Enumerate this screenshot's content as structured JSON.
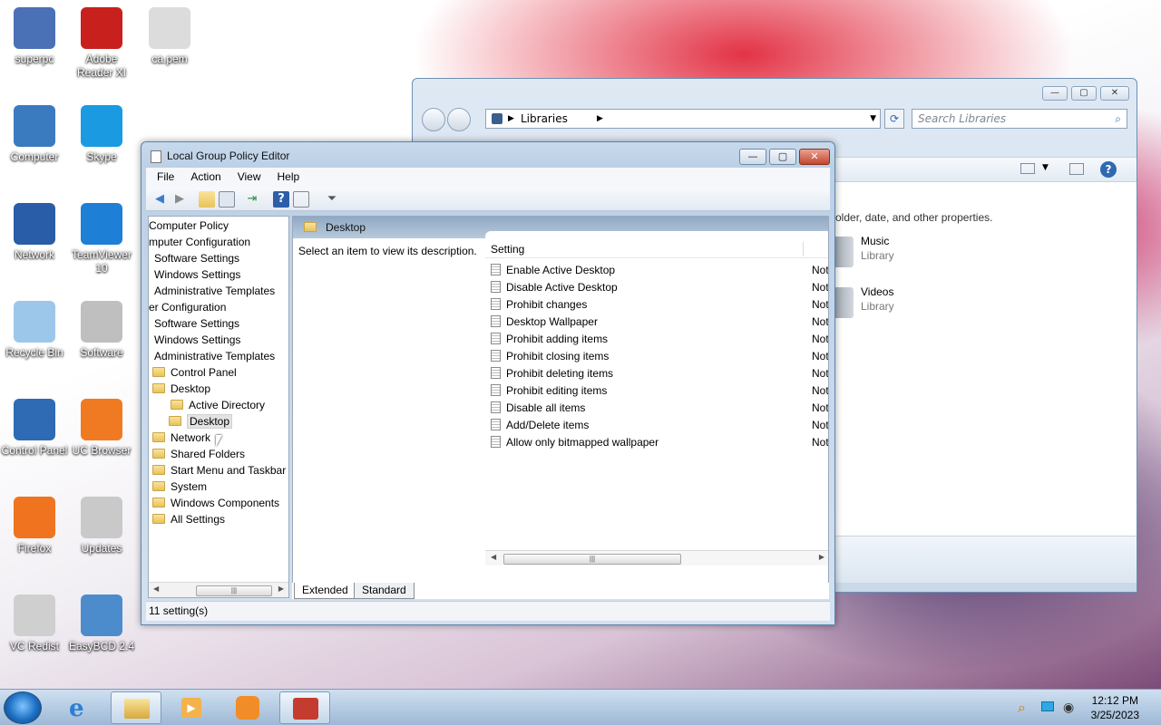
{
  "desktop": {
    "icons": [
      {
        "label": "superpc"
      },
      {
        "label": "Adobe Reader XI"
      },
      {
        "label": "ca.pem"
      },
      {
        "label": "Computer"
      },
      {
        "label": "Skype"
      },
      {
        "label": "Network"
      },
      {
        "label": "TeamViewer 10"
      },
      {
        "label": "Recycle Bin"
      },
      {
        "label": "Software"
      },
      {
        "label": "Control Panel"
      },
      {
        "label": "UC Browser"
      },
      {
        "label": "Firefox"
      },
      {
        "label": "Updates"
      },
      {
        "label": "VC Redist"
      },
      {
        "label": "EasyBCD 2.4"
      }
    ]
  },
  "libraries": {
    "address": "Libraries",
    "search_placeholder": "Search Libraries",
    "hint": "older, date, and other properties.",
    "items": [
      {
        "name": "Music",
        "type": "Library"
      },
      {
        "name": "Videos",
        "type": "Library"
      }
    ]
  },
  "gpe": {
    "title": "Local Group Policy Editor",
    "menu": [
      "File",
      "Action",
      "View",
      "Help"
    ],
    "tree": [
      "Computer Policy",
      "mputer Configuration",
      "Software Settings",
      "Windows Settings",
      "Administrative Templates",
      "er Configuration",
      "Software Settings",
      "Windows Settings",
      "Administrative Templates",
      "Control Panel",
      "Desktop",
      "Active Directory",
      "Desktop",
      "Network",
      "Shared Folders",
      "Start Menu and Taskbar",
      "System",
      "Windows Components",
      "All Settings"
    ],
    "folder_title": "Desktop",
    "description": "Select an item to view its description.",
    "column_setting": "Setting",
    "settings": [
      {
        "name": "Enable Active Desktop",
        "state": "Not"
      },
      {
        "name": "Disable Active Desktop",
        "state": "Not"
      },
      {
        "name": "Prohibit changes",
        "state": "Not"
      },
      {
        "name": "Desktop Wallpaper",
        "state": "Not"
      },
      {
        "name": "Prohibit adding items",
        "state": "Not"
      },
      {
        "name": "Prohibit closing items",
        "state": "Not"
      },
      {
        "name": "Prohibit deleting items",
        "state": "Not"
      },
      {
        "name": "Prohibit editing items",
        "state": "Not"
      },
      {
        "name": "Disable all items",
        "state": "Not"
      },
      {
        "name": "Add/Delete items",
        "state": "Not"
      },
      {
        "name": "Allow only bitmapped wallpaper",
        "state": "Not"
      }
    ],
    "tabs": [
      "Extended",
      "Standard"
    ],
    "status": "11 setting(s)"
  },
  "taskbar": {
    "time": "12:12 PM",
    "date": "3/25/2023"
  }
}
